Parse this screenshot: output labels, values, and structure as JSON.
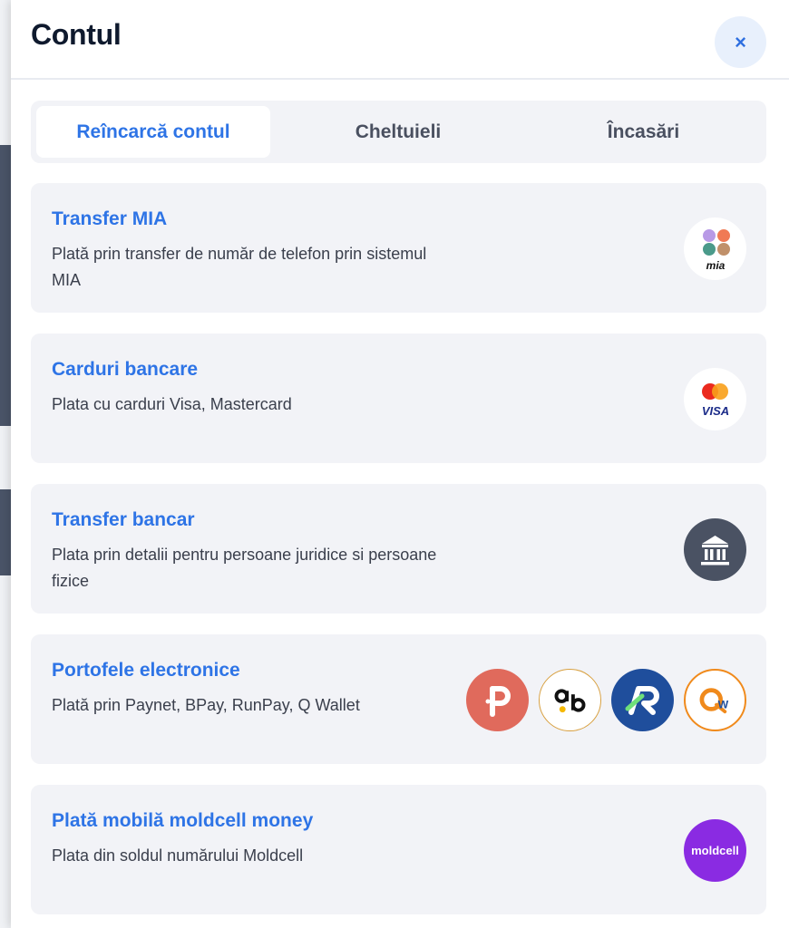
{
  "header": {
    "title": "Contul",
    "close_label": "×"
  },
  "tabs": [
    {
      "label": "Reîncarcă contul",
      "active": true
    },
    {
      "label": "Cheltuieli",
      "active": false
    },
    {
      "label": "Încasări",
      "active": false
    }
  ],
  "methods": [
    {
      "title": "Transfer MIA",
      "description": "Plată prin transfer de număr de telefon prin sistemul MIA",
      "logos": [
        {
          "icon": "mia-logo-icon",
          "text": "mia"
        }
      ]
    },
    {
      "title": "Carduri bancare",
      "description": "Plata cu carduri Visa, Mastercard",
      "logos": [
        {
          "icon": "visa-mastercard-icon",
          "text": "VISA"
        }
      ]
    },
    {
      "title": "Transfer bancar",
      "description": "Plata prin detalii pentru persoane juridice si persoane fizice",
      "logos": [
        {
          "icon": "bank-icon"
        }
      ]
    },
    {
      "title": "Portofele electronice",
      "description": "Plată prin Paynet, BPay, RunPay, Q Wallet",
      "logos": [
        {
          "icon": "paynet-icon",
          "color": "#e06a5c"
        },
        {
          "icon": "bpay-icon"
        },
        {
          "icon": "runpay-icon",
          "color": "#1f4e9c"
        },
        {
          "icon": "qwallet-icon",
          "color": "#f08a1c"
        }
      ]
    },
    {
      "title": "Plată mobilă moldcell money",
      "description": "Plata din soldul numărului Moldcell",
      "logos": [
        {
          "icon": "moldcell-icon",
          "text": "moldcell",
          "color": "#8a2be2"
        }
      ]
    }
  ],
  "colors": {
    "accent": "#2e74e6",
    "card_bg": "#f2f3f7",
    "title": "#0f1a2e"
  }
}
